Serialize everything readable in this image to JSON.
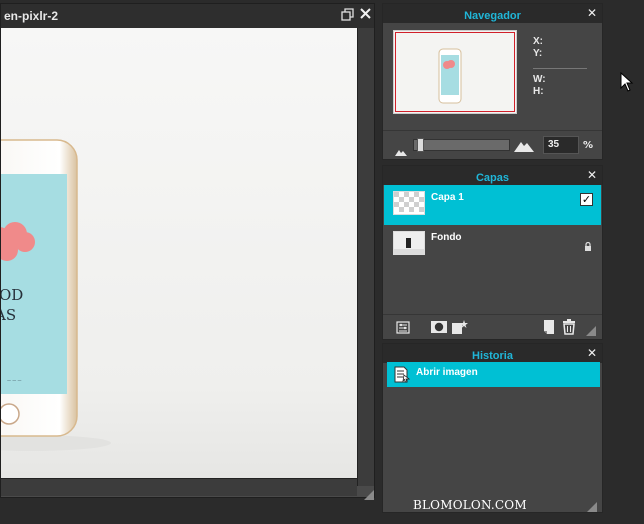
{
  "image_window": {
    "title": "en-pixlr-2"
  },
  "navigator": {
    "title": "Navegador",
    "x_label": "X:",
    "y_label": "Y:",
    "w_label": "W:",
    "h_label": "H:",
    "zoom_value": "35",
    "zoom_unit": "%"
  },
  "layers": {
    "title": "Capas",
    "items": [
      {
        "name": "Capa 1",
        "visible_checked": true
      },
      {
        "name": "Fondo",
        "locked": true
      }
    ]
  },
  "history": {
    "title": "Historia",
    "items": [
      {
        "name": "Abrir imagen"
      }
    ]
  },
  "watermark": "BLOMOLON.COM",
  "colors": {
    "accent": "#00c0d4",
    "header_text": "#20b6d8",
    "panel_bg": "#454545",
    "panel_header": "#2a2a2a",
    "canvas_bg": "#f4f4f2",
    "phone_screen": "#a6dde2",
    "cloud": "#f08a8a"
  }
}
